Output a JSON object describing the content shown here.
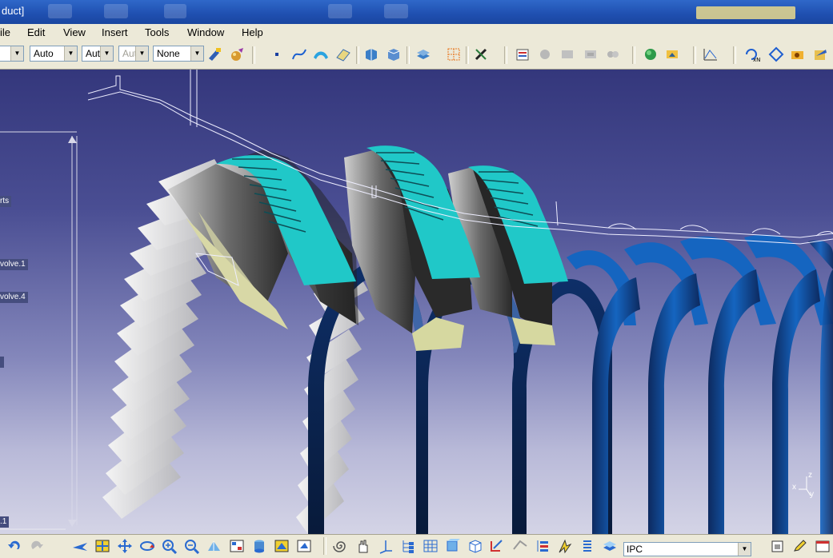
{
  "window": {
    "title": "duct]"
  },
  "menu": {
    "file": "ile",
    "edit": "Edit",
    "view": "View",
    "insert": "Insert",
    "tools": "Tools",
    "window": "Window",
    "help": "Help"
  },
  "toolbar": {
    "combo_line_type": "Auto",
    "combo_thickness": "Aut",
    "combo_point": "Aut",
    "combo_layer": "None"
  },
  "tree": {
    "item_parts": "rts",
    "item_revolve1": "volve.1",
    "item_revolve4": "volve.4",
    "item_last": ".1"
  },
  "status": {
    "command_value": "IPC"
  },
  "compass": {
    "x": "x",
    "y": "y",
    "z": "z"
  },
  "colors": {
    "accent_teal": "#20c8c8",
    "accent_blue": "#1565c0",
    "bg_top": "#34377c",
    "bg_bottom": "#d4d4e6"
  }
}
